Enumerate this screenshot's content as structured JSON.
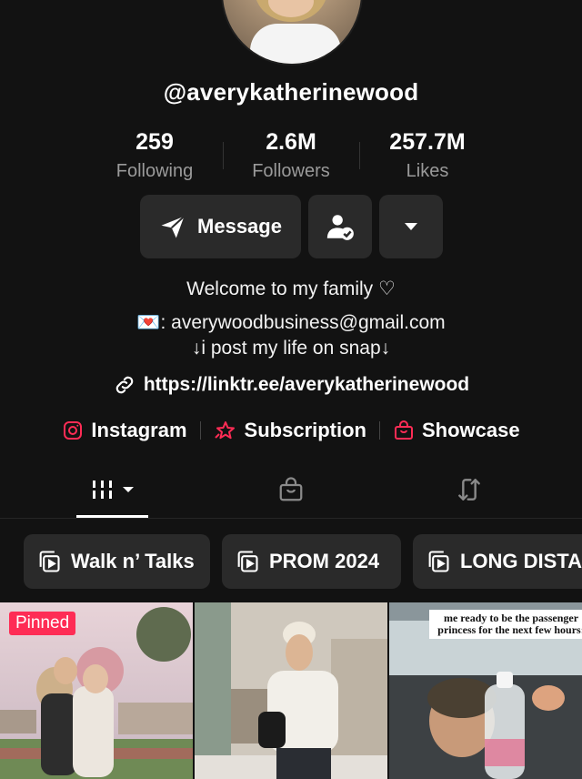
{
  "profile": {
    "username": "@averykatherinewood"
  },
  "stats": [
    {
      "value": "259",
      "label": "Following"
    },
    {
      "value": "2.6M",
      "label": "Followers"
    },
    {
      "value": "257.7M",
      "label": "Likes"
    }
  ],
  "actions": {
    "message_label": "Message",
    "icons": [
      "send-icon",
      "user-check-icon",
      "caret-down-icon"
    ]
  },
  "bio": {
    "line1": "Welcome to my family ♡",
    "line2_emoji": "💌",
    "line2": ": averywoodbusiness@gmail.com",
    "line3": "↓i post my life on snap↓",
    "link": "https://linktr.ee/averykatherinewood"
  },
  "socials": [
    {
      "label": "Instagram",
      "icon": "instagram-icon"
    },
    {
      "label": "Subscription",
      "icon": "subscription-icon"
    },
    {
      "label": "Showcase",
      "icon": "shopping-bag-icon"
    }
  ],
  "tabs": [
    {
      "icon": "grid-icon",
      "active": true
    },
    {
      "icon": "shop-icon",
      "active": false
    },
    {
      "icon": "repost-icon",
      "active": false
    }
  ],
  "playlists": [
    {
      "label": "Walk n’ Talks"
    },
    {
      "label": "PROM 2024"
    },
    {
      "label": "LONG DISTA"
    }
  ],
  "videos": [
    {
      "badge": "Pinned",
      "caption": ""
    },
    {
      "badge": "",
      "caption": ""
    },
    {
      "badge": "",
      "caption": "me ready to be the passenger princess for the next few hours:"
    }
  ],
  "colors": {
    "background": "#121212",
    "button": "#2a2a2a",
    "accent": "#fe2c55",
    "muted_text": "#9a9a9a"
  }
}
